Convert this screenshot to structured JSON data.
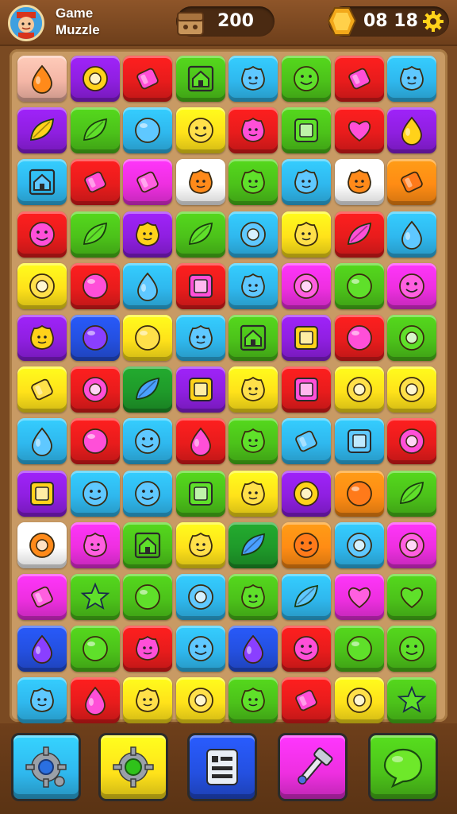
{
  "header": {
    "title_line1": "Game",
    "title_line2": "Muzzle",
    "score": "200",
    "timer": "08 18"
  },
  "colors": {
    "peach": "#f4b6a6",
    "purple": "#8f1fe0",
    "red": "#e81c1c",
    "green": "#4cc21a",
    "cyan": "#2fb8ee",
    "yellow": "#ffe21a",
    "orange": "#ff8c14",
    "magenta": "#ee2fe0",
    "blue": "#2450e0",
    "white": "#ffffff",
    "dgreen": "#1f9a2a"
  },
  "board": {
    "rows": [
      [
        {
          "c": "peach",
          "i": "drop"
        },
        {
          "c": "purple",
          "i": "ring"
        },
        {
          "c": "red",
          "i": "candy"
        },
        {
          "c": "green",
          "i": "house"
        },
        {
          "c": "cyan",
          "i": "blob"
        },
        {
          "c": "green",
          "i": "face"
        },
        {
          "c": "red",
          "i": "candy"
        },
        {
          "c": "cyan",
          "i": "blob"
        }
      ],
      [
        {
          "c": "purple",
          "i": "leaf"
        },
        {
          "c": "green",
          "i": "leaf"
        },
        {
          "c": "cyan",
          "i": "circle"
        },
        {
          "c": "yellow",
          "i": "face"
        },
        {
          "c": "red",
          "i": "blob"
        },
        {
          "c": "green",
          "i": "square"
        },
        {
          "c": "red",
          "i": "heart"
        },
        {
          "c": "purple",
          "i": "drop"
        }
      ],
      [
        {
          "c": "cyan",
          "i": "house"
        },
        {
          "c": "red",
          "i": "candy"
        },
        {
          "c": "magenta",
          "i": "candy"
        },
        {
          "c": "white",
          "i": "blob"
        },
        {
          "c": "green",
          "i": "blob"
        },
        {
          "c": "cyan",
          "i": "blob"
        },
        {
          "c": "white",
          "i": "blob"
        },
        {
          "c": "orange",
          "i": "candy"
        }
      ],
      [
        {
          "c": "red",
          "i": "face"
        },
        {
          "c": "green",
          "i": "leaf"
        },
        {
          "c": "purple",
          "i": "blob"
        },
        {
          "c": "green",
          "i": "leaf"
        },
        {
          "c": "cyan",
          "i": "ring"
        },
        {
          "c": "yellow",
          "i": "blob"
        },
        {
          "c": "red",
          "i": "leaf"
        },
        {
          "c": "cyan",
          "i": "drop"
        }
      ],
      [
        {
          "c": "yellow",
          "i": "ring"
        },
        {
          "c": "red",
          "i": "circle"
        },
        {
          "c": "cyan",
          "i": "drop"
        },
        {
          "c": "red",
          "i": "square"
        },
        {
          "c": "cyan",
          "i": "blob"
        },
        {
          "c": "magenta",
          "i": "ring"
        },
        {
          "c": "green",
          "i": "circle"
        },
        {
          "c": "magenta",
          "i": "face"
        }
      ],
      [
        {
          "c": "purple",
          "i": "blob"
        },
        {
          "c": "blue",
          "i": "circle"
        },
        {
          "c": "yellow",
          "i": "circle"
        },
        {
          "c": "cyan",
          "i": "blob"
        },
        {
          "c": "green",
          "i": "house"
        },
        {
          "c": "purple",
          "i": "square"
        },
        {
          "c": "red",
          "i": "circle"
        },
        {
          "c": "green",
          "i": "ring"
        }
      ],
      [
        {
          "c": "yellow",
          "i": "candy"
        },
        {
          "c": "red",
          "i": "ring"
        },
        {
          "c": "dgreen",
          "i": "leaf"
        },
        {
          "c": "purple",
          "i": "square"
        },
        {
          "c": "yellow",
          "i": "blob"
        },
        {
          "c": "red",
          "i": "square"
        },
        {
          "c": "yellow",
          "i": "ring"
        },
        {
          "c": "yellow",
          "i": "ring"
        }
      ],
      [
        {
          "c": "cyan",
          "i": "drop"
        },
        {
          "c": "red",
          "i": "circle"
        },
        {
          "c": "cyan",
          "i": "face"
        },
        {
          "c": "red",
          "i": "drop"
        },
        {
          "c": "green",
          "i": "blob"
        },
        {
          "c": "cyan",
          "i": "candy"
        },
        {
          "c": "cyan",
          "i": "square"
        },
        {
          "c": "red",
          "i": "ring"
        }
      ],
      [
        {
          "c": "purple",
          "i": "square"
        },
        {
          "c": "cyan",
          "i": "face"
        },
        {
          "c": "cyan",
          "i": "face"
        },
        {
          "c": "green",
          "i": "square"
        },
        {
          "c": "yellow",
          "i": "blob"
        },
        {
          "c": "purple",
          "i": "ring"
        },
        {
          "c": "orange",
          "i": "circle"
        },
        {
          "c": "green",
          "i": "leaf"
        }
      ],
      [
        {
          "c": "white",
          "i": "ring"
        },
        {
          "c": "magenta",
          "i": "blob"
        },
        {
          "c": "green",
          "i": "house"
        },
        {
          "c": "yellow",
          "i": "blob"
        },
        {
          "c": "dgreen",
          "i": "leaf"
        },
        {
          "c": "orange",
          "i": "face"
        },
        {
          "c": "cyan",
          "i": "ring"
        },
        {
          "c": "magenta",
          "i": "ring"
        }
      ],
      [
        {
          "c": "magenta",
          "i": "candy"
        },
        {
          "c": "green",
          "i": "star"
        },
        {
          "c": "green",
          "i": "circle"
        },
        {
          "c": "cyan",
          "i": "ring"
        },
        {
          "c": "green",
          "i": "blob"
        },
        {
          "c": "cyan",
          "i": "leaf"
        },
        {
          "c": "magenta",
          "i": "heart"
        },
        {
          "c": "green",
          "i": "heart"
        }
      ],
      [
        {
          "c": "blue",
          "i": "drop"
        },
        {
          "c": "green",
          "i": "circle"
        },
        {
          "c": "red",
          "i": "blob"
        },
        {
          "c": "cyan",
          "i": "face"
        },
        {
          "c": "blue",
          "i": "drop"
        },
        {
          "c": "red",
          "i": "face"
        },
        {
          "c": "green",
          "i": "circle"
        },
        {
          "c": "green",
          "i": "face"
        }
      ],
      [
        {
          "c": "cyan",
          "i": "blob"
        },
        {
          "c": "red",
          "i": "drop"
        },
        {
          "c": "yellow",
          "i": "blob"
        },
        {
          "c": "yellow",
          "i": "ring"
        },
        {
          "c": "green",
          "i": "blob"
        },
        {
          "c": "red",
          "i": "candy"
        },
        {
          "c": "yellow",
          "i": "ring"
        },
        {
          "c": "green",
          "i": "star"
        }
      ]
    ]
  },
  "toolbar": [
    {
      "name": "settings-gear-button",
      "icon": "gear-blue-icon",
      "color": "cyan"
    },
    {
      "name": "gear-green-button",
      "icon": "gear-green-icon",
      "color": "yellow"
    },
    {
      "name": "menu-list-button",
      "icon": "list-icon",
      "color": "blue"
    },
    {
      "name": "hammer-tool-button",
      "icon": "hammer-icon",
      "color": "magenta"
    },
    {
      "name": "chat-hint-button",
      "icon": "chat-bubble-icon",
      "color": "green"
    }
  ]
}
